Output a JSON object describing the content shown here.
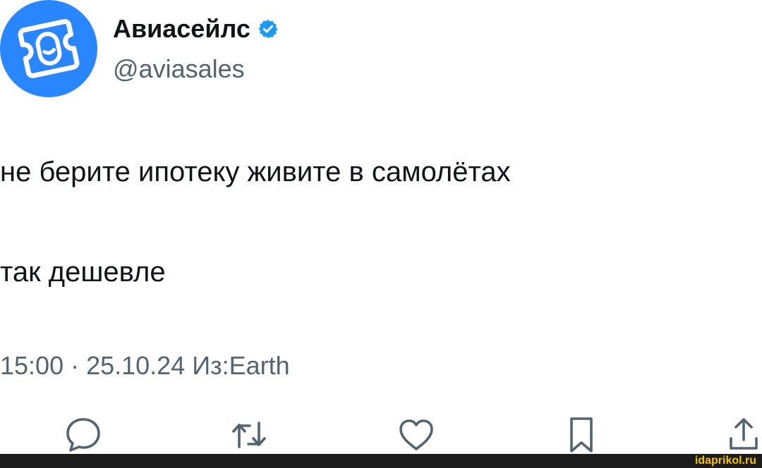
{
  "profile": {
    "display_name": "Авиасейлс",
    "handle": "@aviasales",
    "verified": true,
    "avatar_icon": "aviasales-ticket-logo",
    "avatar_color": "#2a86ff",
    "verified_badge_color": "#1d9bf0"
  },
  "tweet": {
    "line1": "не берите ипотеку живите в самолётах",
    "line2": "так дешевле"
  },
  "meta": {
    "text": "15:00 · 25.10.24 Из:Earth"
  },
  "actions": [
    {
      "name": "reply",
      "icon": "speech-bubble-icon"
    },
    {
      "name": "retweet",
      "icon": "retweet-arrows-icon"
    },
    {
      "name": "like",
      "icon": "heart-icon"
    },
    {
      "name": "bookmark",
      "icon": "bookmark-icon"
    },
    {
      "name": "share",
      "icon": "share-upload-icon"
    }
  ],
  "watermark": {
    "text": "idaprikol.ru",
    "color": "#f5c400"
  },
  "colors": {
    "text_primary": "#0f1419",
    "text_secondary": "#536471",
    "icon": "#536471"
  }
}
